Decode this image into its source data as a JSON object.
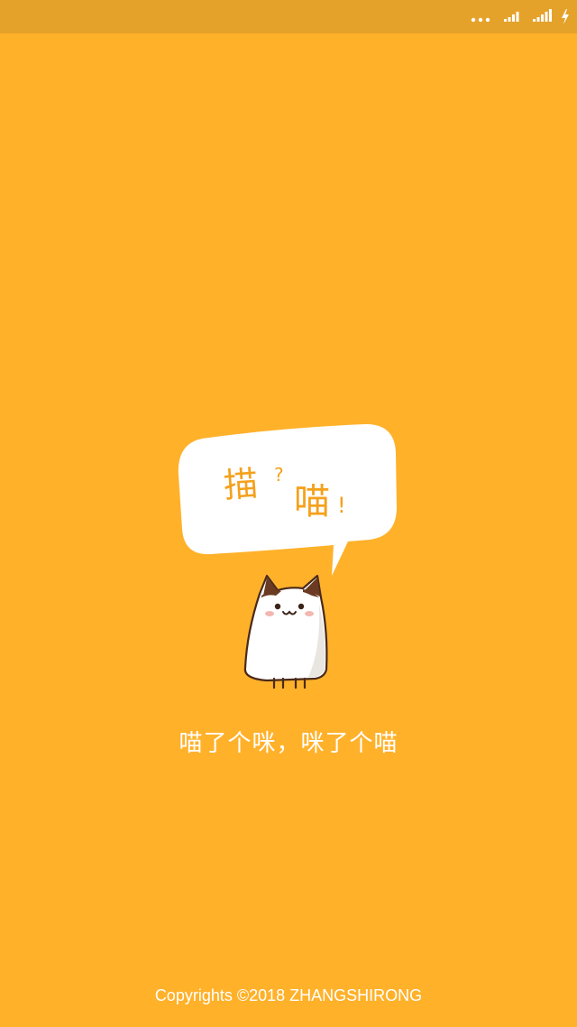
{
  "colors": {
    "background": "#FFB12A",
    "status_bar": "#E5A22A",
    "bubble_text": "#F4A11C",
    "text": "#FFFFFF"
  },
  "status_bar": {
    "icons": [
      "more-dots-icon",
      "signal-icon",
      "signal-icon",
      "charging-bolt-icon"
    ]
  },
  "bubble": {
    "word_1": "描",
    "mark_1": "?",
    "word_2": "喵",
    "mark_2": "!"
  },
  "slogan": "喵了个咪，咪了个喵",
  "copyright": "Copyrights ©2018 ZHANGSHIRONG"
}
